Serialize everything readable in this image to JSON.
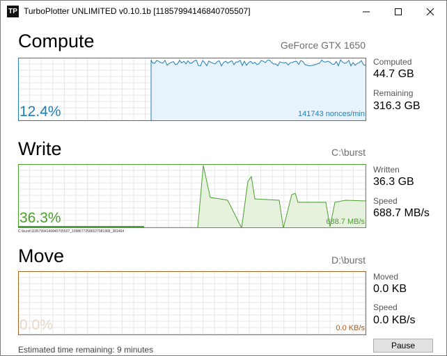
{
  "window": {
    "icon_text": "TP",
    "title": "TurboPlotter UNLIMITED v0.10.1b [11857994146840705507]"
  },
  "compute": {
    "title": "Compute",
    "device": "GeForce GTX 1650",
    "percent": "12.4%",
    "rate": "141743 nonces/min",
    "computed_label": "Computed",
    "computed_value": "44.7 GB",
    "remaining_label": "Remaining",
    "remaining_value": "316.3 GB",
    "color": "#1f7fb6",
    "fill": "#e8f2fa"
  },
  "write": {
    "title": "Write",
    "path": "C:\\burst",
    "percent": "36.3%",
    "rate": "688.7 MB/s",
    "file_path": "C:\\burst\\11857994146840705507_10986772586527981868_381464",
    "written_label": "Written",
    "written_value": "36.3 GB",
    "speed_label": "Speed",
    "speed_value": "688.7 MB/s",
    "color": "#4aa02c",
    "fill": "#e6f2de"
  },
  "move": {
    "title": "Move",
    "path": "D:\\burst",
    "percent": "0.0%",
    "rate": "0.0 KB/s",
    "moved_label": "Moved",
    "moved_value": "0.0 KB",
    "speed_label": "Speed",
    "speed_value": "0.0 KB/s",
    "color": "#a8601e"
  },
  "status": {
    "text": "Estimated time remaining: 9 minutes"
  },
  "pause_button": {
    "label": "Pause"
  }
}
